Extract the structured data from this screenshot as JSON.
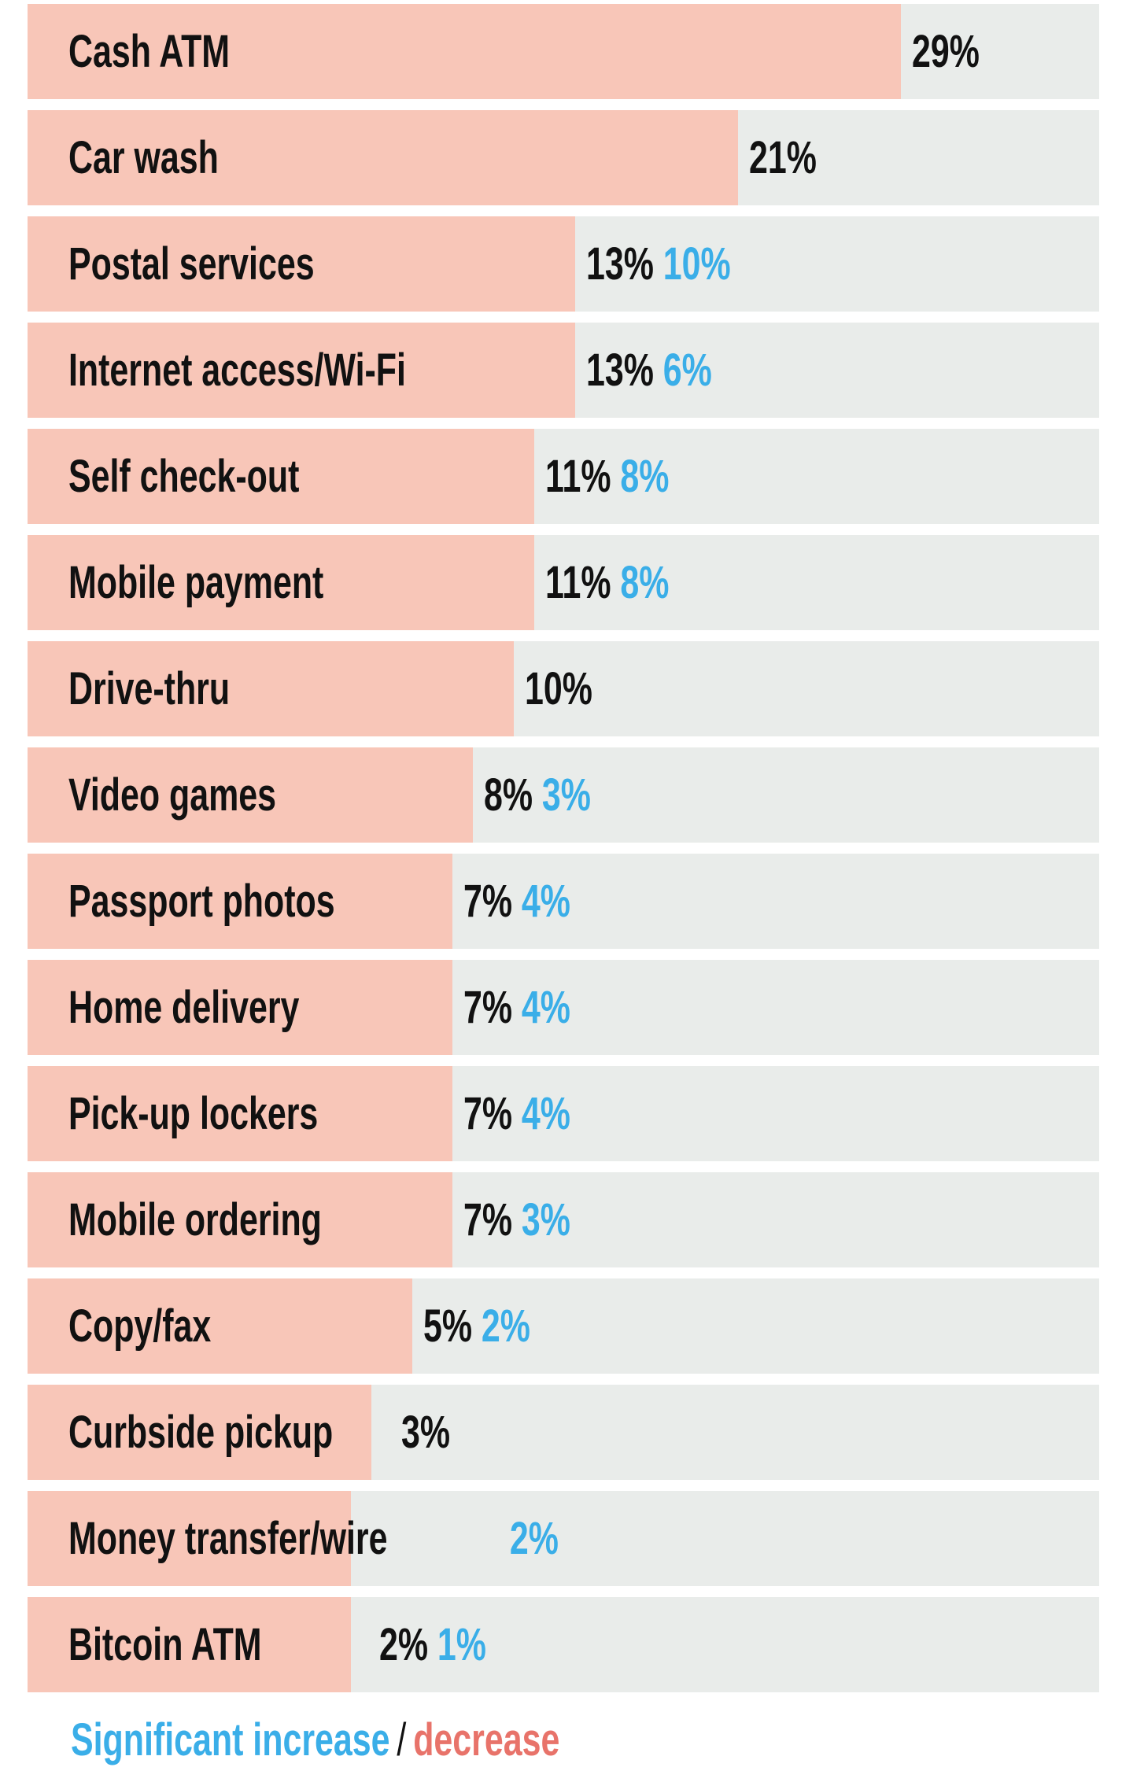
{
  "chart_data": {
    "type": "bar",
    "orientation": "horizontal",
    "title": "",
    "xlabel": "",
    "ylabel": "",
    "categories": [
      "Cash ATM",
      "Car wash",
      "Postal services",
      "Internet access/Wi-Fi",
      "Self check-out",
      "Mobile payment",
      "Drive-thru",
      "Video games",
      "Passport photos",
      "Home delivery",
      "Pick-up lockers",
      "Mobile ordering",
      "Copy/fax",
      "Curbside pickup",
      "Money transfer/wire",
      "Bitcoin ATM"
    ],
    "values": [
      29,
      21,
      13,
      13,
      11,
      11,
      10,
      8,
      7,
      7,
      7,
      7,
      5,
      3,
      2,
      2
    ],
    "value_labels": [
      "29%",
      "21%",
      "13%",
      "13%",
      "11%",
      "11%",
      "10%",
      "8%",
      "7%",
      "7%",
      "7%",
      "7%",
      "5%",
      "3%",
      "",
      "2%"
    ],
    "change_labels": [
      "",
      "",
      "10%",
      "6%",
      "8%",
      "8%",
      "",
      "3%",
      "4%",
      "4%",
      "4%",
      "3%",
      "2%",
      "",
      "2%",
      "1%"
    ],
    "change_direction": [
      "",
      "",
      "increase",
      "increase",
      "increase",
      "increase",
      "",
      "increase",
      "increase",
      "increase",
      "increase",
      "increase",
      "increase",
      "",
      "increase",
      "increase"
    ],
    "grid": false,
    "legend": {
      "position": "bottom-left",
      "increase_label": "Significant increase",
      "separator": "/",
      "decrease_label": "decrease"
    },
    "colors": {
      "bar": "#f8c6b8",
      "track": "#e9ecea",
      "increase": "#3aaee8",
      "decrease": "#e8736a",
      "text": "#111111"
    }
  }
}
